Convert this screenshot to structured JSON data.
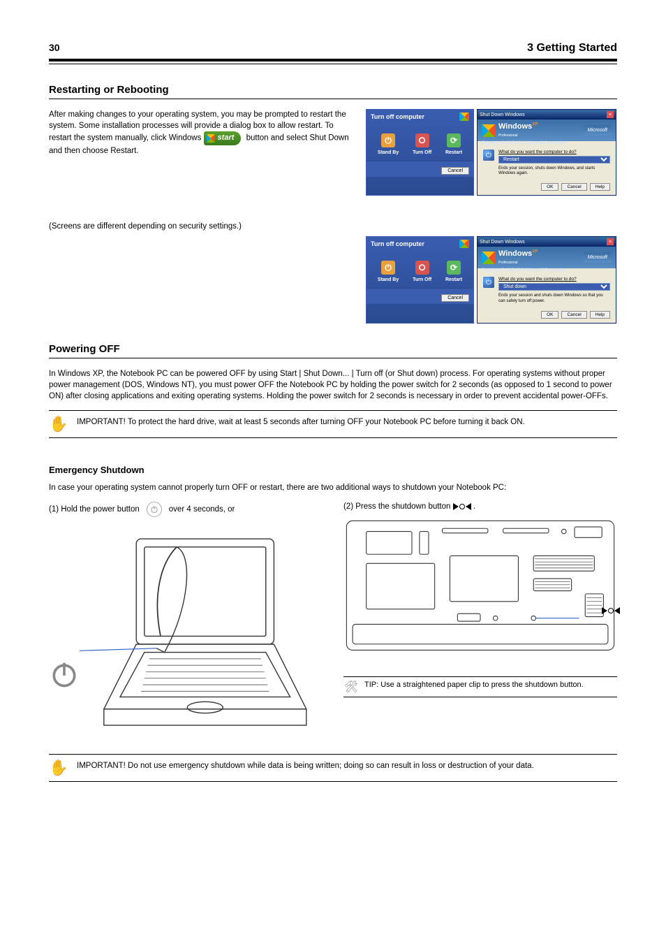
{
  "header": {
    "page_number": "30",
    "chapter": "3    Getting Started"
  },
  "restart": {
    "title": "Restarting or Rebooting",
    "p1_before_start": "After making changes to your operating system, you may be prompted to restart the system. Some installation processes will provide a dialog box to allow restart. To restart the system manually, click Windows ",
    "start_label": "start",
    "p1_after_start": " button and select Shut Down and then choose Restart.",
    "p2": "(Screens are different depending on security settings.)"
  },
  "poweroff": {
    "title": "Powering OFF",
    "p1": "In Windows XP, the Notebook PC can be powered OFF by using Start | Shut Down... | Turn off (or Shut down) process. For operating systems without proper power management (DOS, Windows NT), you must power OFF the Notebook PC by holding the power switch for 2 seconds (as opposed to 1 second to power ON) after closing applications and exiting operating systems. Holding the power switch for 2 seconds is necessary in order to prevent accidental power-OFFs.",
    "important": "IMPORTANT! To protect the hard drive, wait at least 5 seconds after turning OFF your Notebook PC before turning it back ON.",
    "emergency": {
      "title": "Emergency Shutdown",
      "intro": "In case your operating system cannot properly turn OFF or restart, there are two additional ways to shutdown your Notebook PC:",
      "opt1_before": "(1) Hold the power button ",
      "opt1_after": " over 4 seconds, or",
      "opt2_before": "(2) Press the shutdown button ",
      "opt2_after": ".",
      "tip": "TIP: Use a straightened paper clip to press the shutdown button.",
      "important2": "IMPORTANT! Do not use emergency shutdown while data is being written; doing so can result in loss or destruction of your data."
    }
  },
  "dlg": {
    "turnoff_title": "Turn off computer",
    "standby": "Stand By",
    "turnoff": "Turn Off",
    "restart": "Restart",
    "cancel": "Cancel",
    "shutdown_title": "Shut Down Windows",
    "windows": "Windows",
    "xp": "XP",
    "professional": "Professional",
    "copyright": "Copyright © 1985-2001 Microsoft Corporation",
    "microsoft": "Microsoft",
    "prompt": "What do you want the computer to do?",
    "opt_restart": "Restart",
    "opt_shutdown": "Shut down",
    "desc_restart": "Ends your session, shuts down Windows, and starts Windows again.",
    "desc_shutdown": "Ends your session and shuts down Windows so that you can safely turn off power.",
    "ok": "OK",
    "help": "Help"
  }
}
